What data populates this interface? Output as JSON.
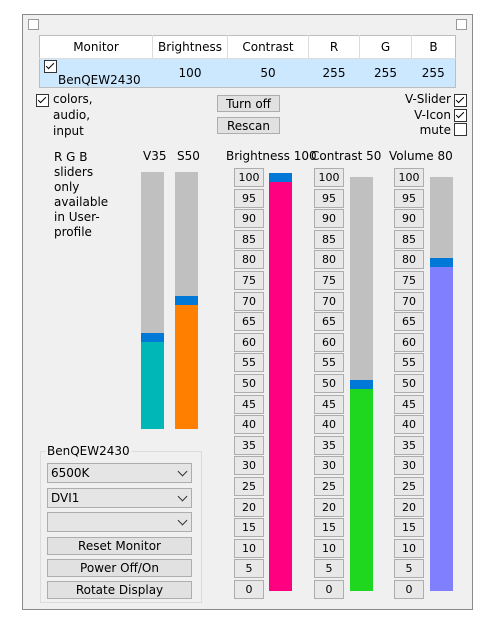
{
  "table": {
    "headers": [
      "Monitor",
      "Brightness",
      "Contrast",
      "R",
      "G",
      "B"
    ],
    "row": {
      "monitor": "BenQEW2430",
      "brightness": "100",
      "contrast": "50",
      "r": "255",
      "g": "255",
      "b": "255"
    }
  },
  "options": {
    "colors_label": "colors,\naudio,\ninput",
    "turn_off": "Turn off",
    "rescan": "Rescan",
    "v_slider": "V-Slider",
    "v_icon": "V-Icon",
    "mute": "mute"
  },
  "note": "R G B\nsliders\nonly\navailable\nin User-\nprofile",
  "sliders": {
    "v35": {
      "label": "V35",
      "value": 35,
      "color": "#00b7b7"
    },
    "s50": {
      "label": "S50",
      "value": 50,
      "color": "#ff8000"
    },
    "brightness": {
      "label": "Brightness 100",
      "value": 100,
      "color": "#ff0080"
    },
    "contrast": {
      "label": "Contrast 50",
      "value": 50,
      "color": "#1ed71e"
    },
    "volume": {
      "label": "Volume 80",
      "value": 80,
      "color": "#8080ff"
    }
  },
  "ticks": [
    "100",
    "95",
    "90",
    "85",
    "80",
    "75",
    "70",
    "65",
    "60",
    "55",
    "50",
    "45",
    "40",
    "35",
    "30",
    "25",
    "20",
    "15",
    "10",
    "5",
    "0"
  ],
  "monitor_group": {
    "title": "BenQEW2430",
    "color_temp": "6500K",
    "input": "DVI1",
    "extra": "",
    "reset": "Reset Monitor",
    "power": "Power Off/On",
    "rotate": "Rotate Display"
  },
  "colors": {
    "thumb": "#0078d7",
    "track": "#c0c0c0",
    "selection": "#cce8ff"
  }
}
